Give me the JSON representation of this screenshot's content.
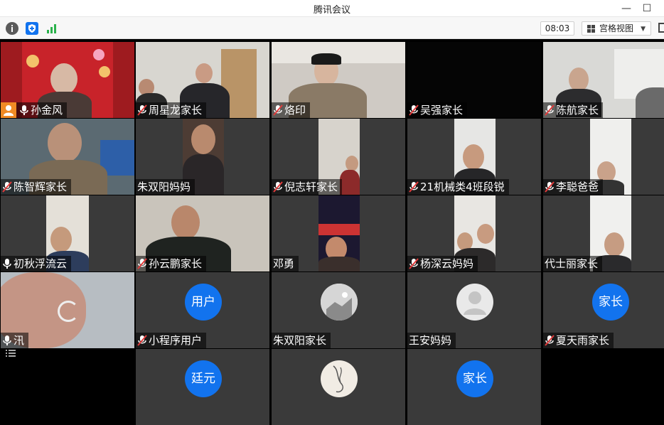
{
  "window": {
    "title": "腾讯会议"
  },
  "toolbar": {
    "icons": [
      "info-icon",
      "shield-icon",
      "signal-icon"
    ],
    "timer": "08:03",
    "view_label": "宫格视图"
  },
  "colors": {
    "accent": "#1273ee",
    "tile_bg": "#3a3a3a",
    "muted_mic": "#e33b3b"
  },
  "participants": [
    {
      "name": "孙金风",
      "mic": "on",
      "host_badge": true
    },
    {
      "name": "周星龙家长",
      "mic": "muted"
    },
    {
      "name": "烙印",
      "mic": "muted"
    },
    {
      "name": "吴强家长",
      "mic": "muted"
    },
    {
      "name": "陈航家长",
      "mic": "muted"
    },
    {
      "name": "陈智辉家长",
      "mic": "muted"
    },
    {
      "name": "朱双阳妈妈",
      "mic": "none"
    },
    {
      "name": "倪志轩家长",
      "mic": "muted"
    },
    {
      "name": "21机械类4班段锐",
      "mic": "muted"
    },
    {
      "name": "李聪爸爸",
      "mic": "muted"
    },
    {
      "name": "初秋浮流云",
      "mic": "on"
    },
    {
      "name": "孙云鹏家长",
      "mic": "muted"
    },
    {
      "name": "邓勇",
      "mic": "none"
    },
    {
      "name": "杨深云妈妈",
      "mic": "muted"
    },
    {
      "name": "代士丽家长",
      "mic": "none"
    },
    {
      "name": "汛",
      "mic": "on"
    },
    {
      "name": "小程序用户",
      "mic": "muted",
      "avatar_text": "用户"
    },
    {
      "name": "朱双阳家长",
      "mic": "none"
    },
    {
      "name": "王安妈妈",
      "mic": "none"
    },
    {
      "name": "夏天雨家长",
      "mic": "muted",
      "avatar_text": "家长"
    },
    {
      "avatar_text": "廷元"
    },
    {
      "avatar_text": "家长"
    }
  ]
}
